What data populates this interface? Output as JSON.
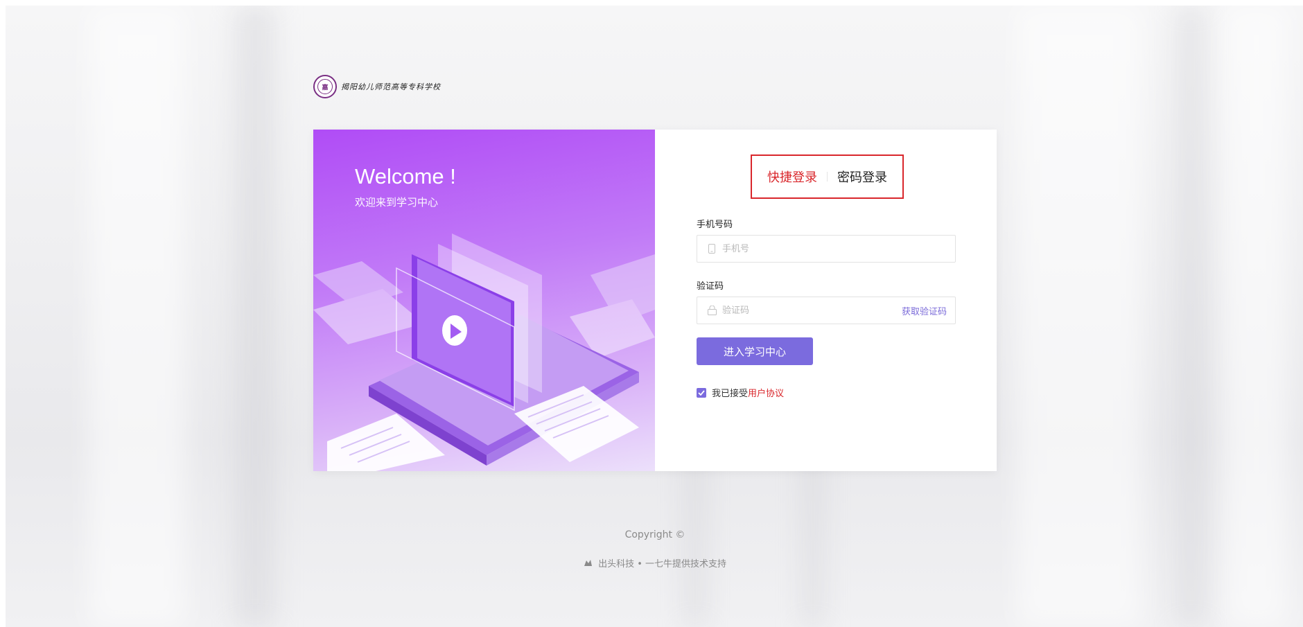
{
  "logo": {
    "seal_text": "嘉",
    "school_name": "揭阳幼儿师范高等专科学校"
  },
  "hero": {
    "welcome": "Welcome !",
    "subtitle": "欢迎来到学习中心",
    "illustration": "book-laptop-video-illustration"
  },
  "login": {
    "tabs": [
      {
        "label": "快捷登录",
        "active": true
      },
      {
        "label": "密码登录",
        "active": false
      }
    ],
    "phone_label": "手机号码",
    "phone_placeholder": "手机号",
    "code_label": "验证码",
    "code_placeholder": "验证码",
    "get_code": "获取验证码",
    "submit": "进入学习中心",
    "agree_prefix": "我已接受",
    "agree_link": "用户协议",
    "agree_checked": true
  },
  "footer": {
    "copyright": "Copyright ©",
    "support": "出头科技 • 一七牛提供技术支持"
  },
  "colors": {
    "accent": "#7b6bde",
    "highlight": "#d9262b",
    "hero": "#b04cf6"
  }
}
